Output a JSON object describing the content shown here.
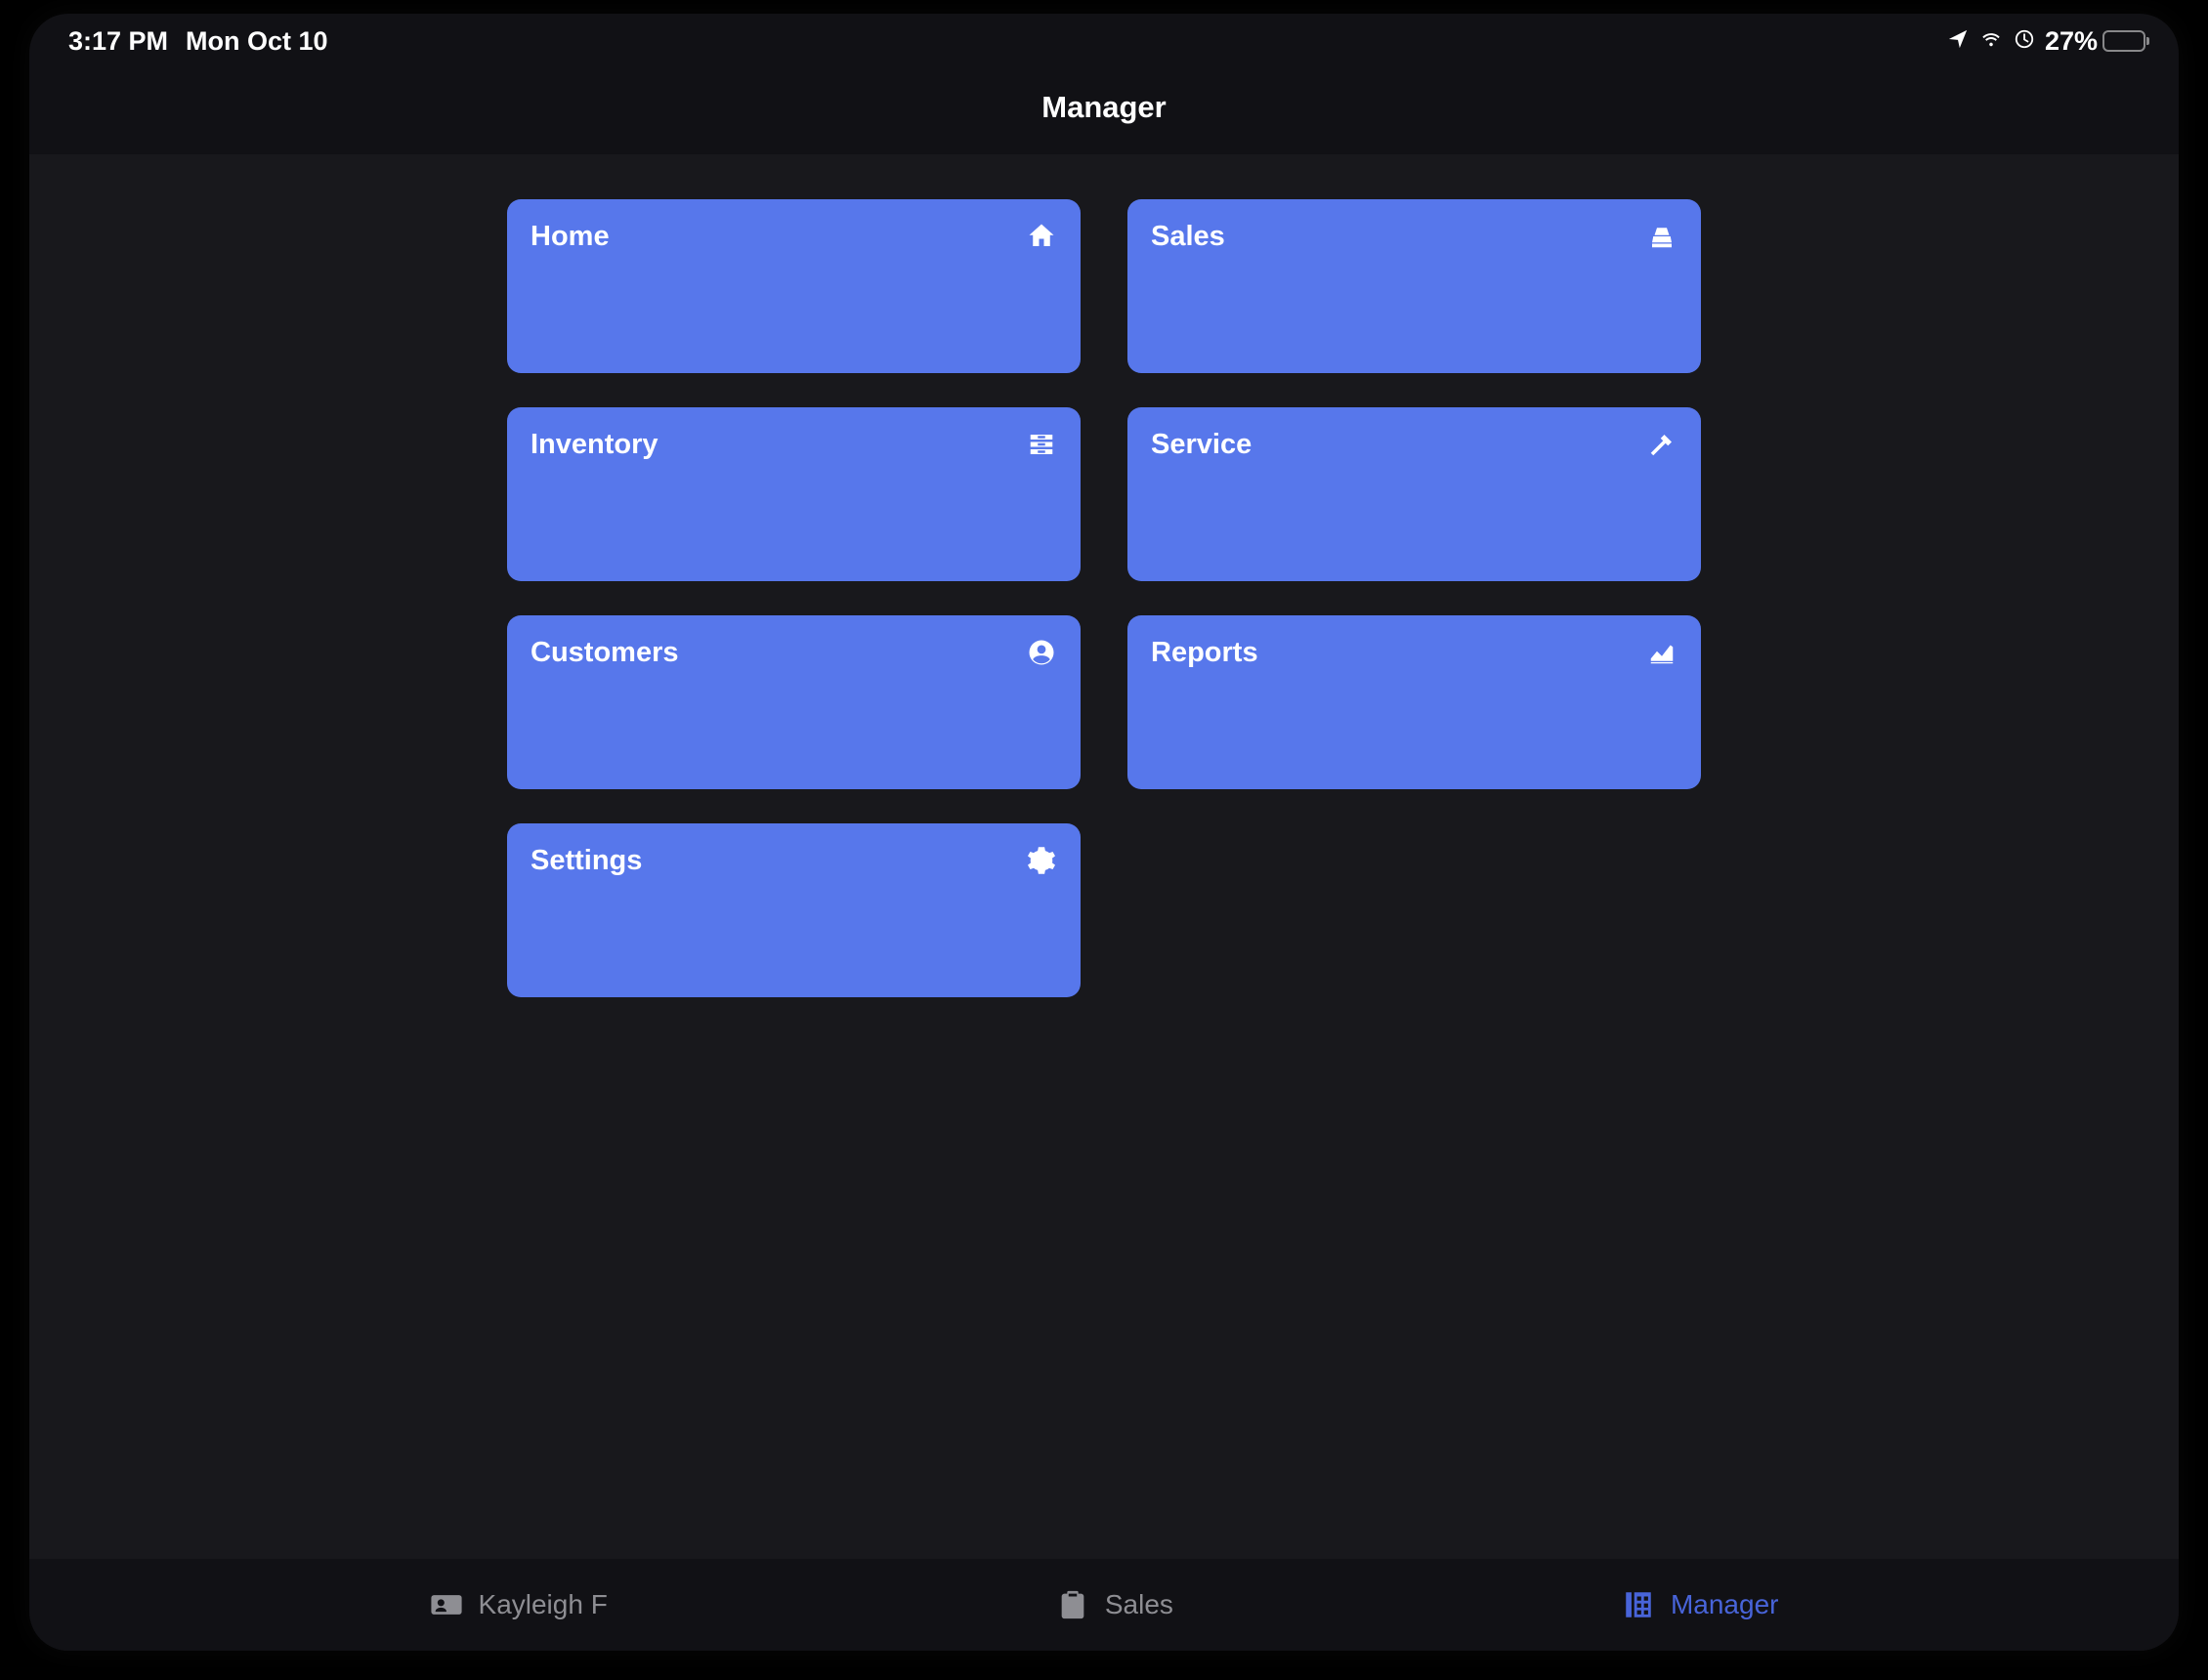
{
  "status_bar": {
    "time": "3:17 PM",
    "date": "Mon Oct 10",
    "battery_percent": "27%"
  },
  "header": {
    "title": "Manager"
  },
  "tiles": [
    {
      "label": "Home",
      "icon": "home-icon"
    },
    {
      "label": "Sales",
      "icon": "cash-register-icon"
    },
    {
      "label": "Inventory",
      "icon": "drawer-icon"
    },
    {
      "label": "Service",
      "icon": "hammer-icon"
    },
    {
      "label": "Customers",
      "icon": "person-circle-icon"
    },
    {
      "label": "Reports",
      "icon": "chart-line-icon"
    },
    {
      "label": "Settings",
      "icon": "gear-icon"
    }
  ],
  "tab_bar": {
    "items": [
      {
        "label": "Kayleigh F",
        "icon": "id-card-icon",
        "active": false
      },
      {
        "label": "Sales",
        "icon": "clipboard-icon",
        "active": false
      },
      {
        "label": "Manager",
        "icon": "building-icon",
        "active": true
      }
    ]
  }
}
